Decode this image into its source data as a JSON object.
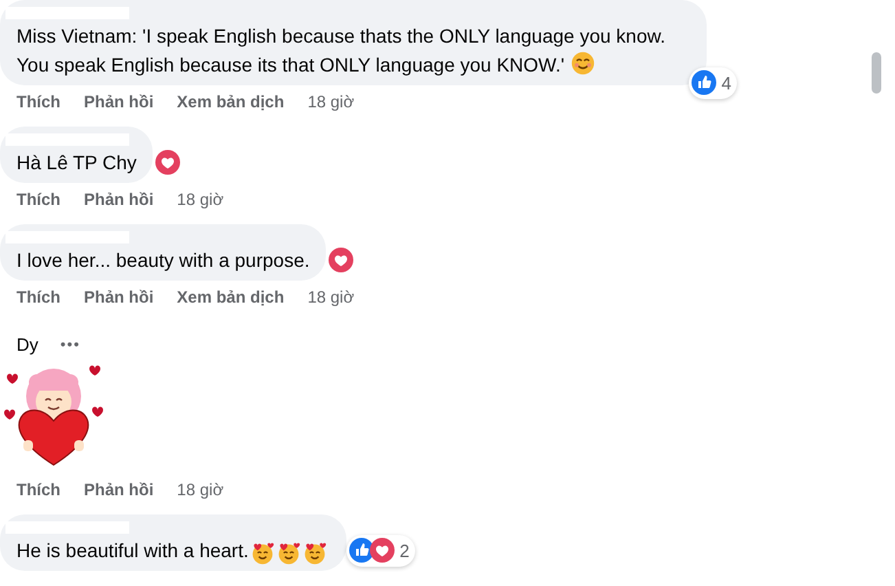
{
  "comments": [
    {
      "kind": "text",
      "text": "Miss Vietnam: 'I speak English because thats the ONLY language you know. You speak English because its that ONLY language you KNOW.'",
      "emoji": [
        {
          "kind": "smile"
        }
      ],
      "reactions": {
        "icons": [
          {
            "kind": "like"
          }
        ],
        "count": "4"
      },
      "actions": [
        "Thích",
        "Phản hồi",
        "Xem bản dịch"
      ],
      "time": "18 giờ"
    },
    {
      "kind": "text",
      "text": "Hà Lê TP Chy",
      "reactions": {
        "icons": [
          {
            "kind": "love"
          }
        ]
      },
      "actions": [
        "Thích",
        "Phản hồi"
      ],
      "time": "18 giờ"
    },
    {
      "kind": "text",
      "text": "I love her... beauty with a purpose.",
      "reactions": {
        "icons": [
          {
            "kind": "love"
          }
        ]
      },
      "actions": [
        "Thích",
        "Phản hồi",
        "Xem bản dịch"
      ],
      "time": "18 giờ"
    },
    {
      "kind": "sticker",
      "author": "Dy",
      "menu": "•••",
      "actions": [
        "Thích",
        "Phản hồi"
      ],
      "time": "18 giờ"
    },
    {
      "kind": "text",
      "text": "He is beautiful with a heart.",
      "emoji": [
        {
          "kind": "hearts"
        },
        {
          "kind": "hearts"
        },
        {
          "kind": "hearts"
        }
      ],
      "reactions": {
        "icons": [
          {
            "kind": "like"
          },
          {
            "kind": "love"
          }
        ],
        "count": "2"
      }
    }
  ]
}
